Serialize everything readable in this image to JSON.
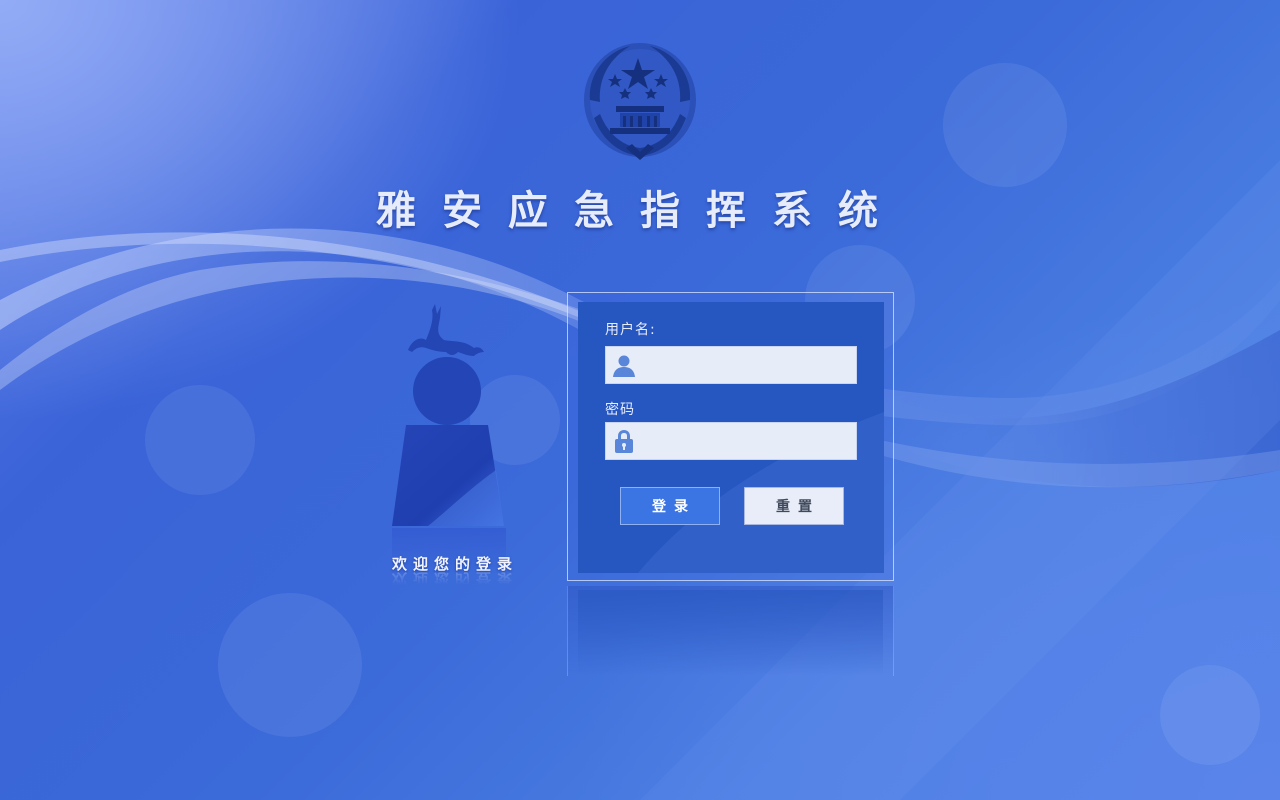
{
  "app": {
    "title": "雅安应急指挥系统",
    "welcome": "欢迎您的登录"
  },
  "login": {
    "username_label": "用户名:",
    "username_value": "",
    "username_icon": "user-icon",
    "password_label": "密码",
    "password_value": "",
    "password_icon": "lock-icon",
    "login_button": "登录",
    "reset_button": "重置"
  },
  "colors": {
    "background": "#3b6ad9",
    "panel": "#2656bf",
    "field": "#e7ecf9",
    "login_button": "#3b74e3",
    "reset_button": "#e8edf9",
    "title_text": "#e7ecfb"
  }
}
